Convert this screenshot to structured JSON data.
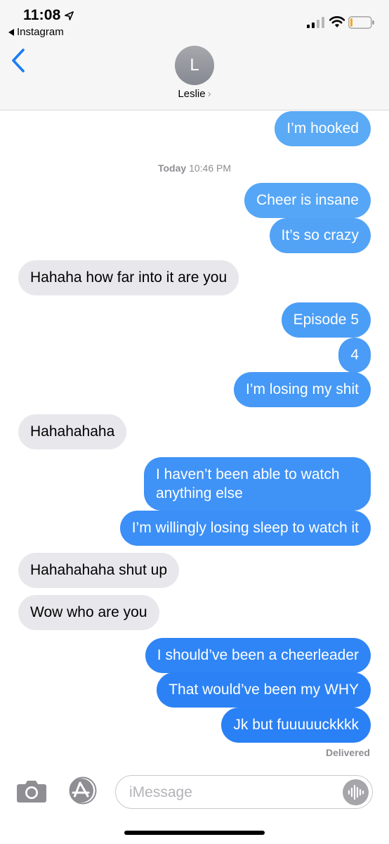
{
  "status_bar": {
    "time": "11:08",
    "back_app": "Instagram"
  },
  "nav": {
    "avatar_initial": "L",
    "contact_name": "Leslie",
    "chevron": "›"
  },
  "timestamp": {
    "day": "Today",
    "time": "10:46 PM"
  },
  "messages": [
    {
      "from": "me",
      "text": "I’m hooked"
    },
    {
      "from": "me",
      "text": "Cheer is insane"
    },
    {
      "from": "me",
      "text": "It’s so crazy"
    },
    {
      "from": "them",
      "text": "Hahaha how far into it are you"
    },
    {
      "from": "me",
      "text": "Episode 5"
    },
    {
      "from": "me",
      "text": "4"
    },
    {
      "from": "me",
      "text": "I’m losing my shit"
    },
    {
      "from": "them",
      "text": "Hahahahaha"
    },
    {
      "from": "me",
      "text": "I haven’t been able to watch anything else"
    },
    {
      "from": "me",
      "text": "I’m willingly losing sleep to watch it"
    },
    {
      "from": "them",
      "text": "Hahahahaha shut up"
    },
    {
      "from": "them",
      "text": "Wow who are you"
    },
    {
      "from": "me",
      "text": "I should’ve been a cheerleader"
    },
    {
      "from": "me",
      "text": "That would’ve been my WHY"
    },
    {
      "from": "me",
      "text": "Jk but fuuuuuckkkk"
    }
  ],
  "delivery_status": "Delivered",
  "composer": {
    "placeholder": "iMessage"
  },
  "colors": {
    "accent": "#1a7cf5",
    "incoming_bubble": "#e8e8ec"
  }
}
